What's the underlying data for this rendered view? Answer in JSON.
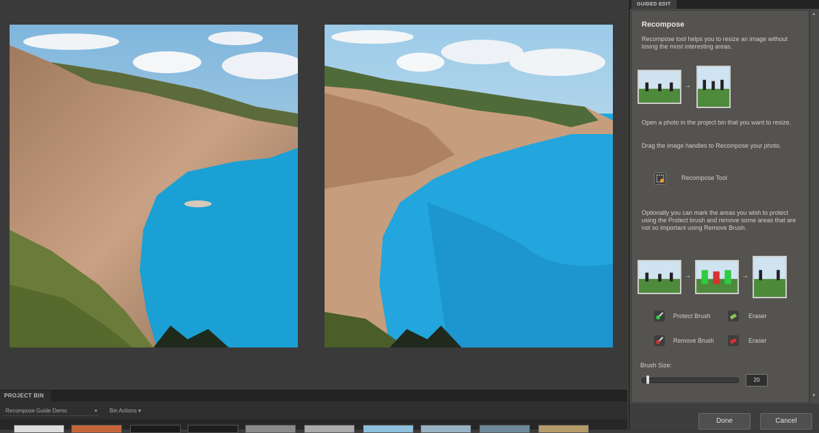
{
  "panel": {
    "tab_label": "GUIDED EDIT",
    "heading": "Recompose",
    "intro": "Recompose tool helps you to resize an image without losing the most interesting areas.",
    "step1": "Open a photo in the project bin that you want to resize.",
    "step2": "Drag the image handles to Recompose your photo.",
    "recompose_tool_label": "Recompose Tool",
    "optional_text": "Optionally you can mark the areas you wish to protect using the Protect brush and remove some areas that are not so important using Remove Brush.",
    "protect_brush_label": "Protect Brush",
    "eraser_label_1": "Eraser",
    "remove_brush_label": "Remove Brush",
    "eraser_label_2": "Eraser",
    "brush_size_label": "Brush Size:",
    "brush_size_value": "20",
    "brush_size_fraction": 0.05,
    "done_label": "Done",
    "cancel_label": "Cancel"
  },
  "project_bin": {
    "tab_label": "PROJECT BIN",
    "select_value": "Recompose Guide Demo",
    "actions_label": "Bin Actions"
  },
  "colors": {
    "sea": "#1fa3d6",
    "sky": "#8ec4e6",
    "protect_green": "#2ecc40",
    "remove_red": "#d6322f"
  },
  "icons": {
    "recompose_tool": "recompose-tool-icon",
    "protect_brush": "protect-brush-icon",
    "eraser": "eraser-icon",
    "remove_brush": "remove-brush-icon"
  }
}
